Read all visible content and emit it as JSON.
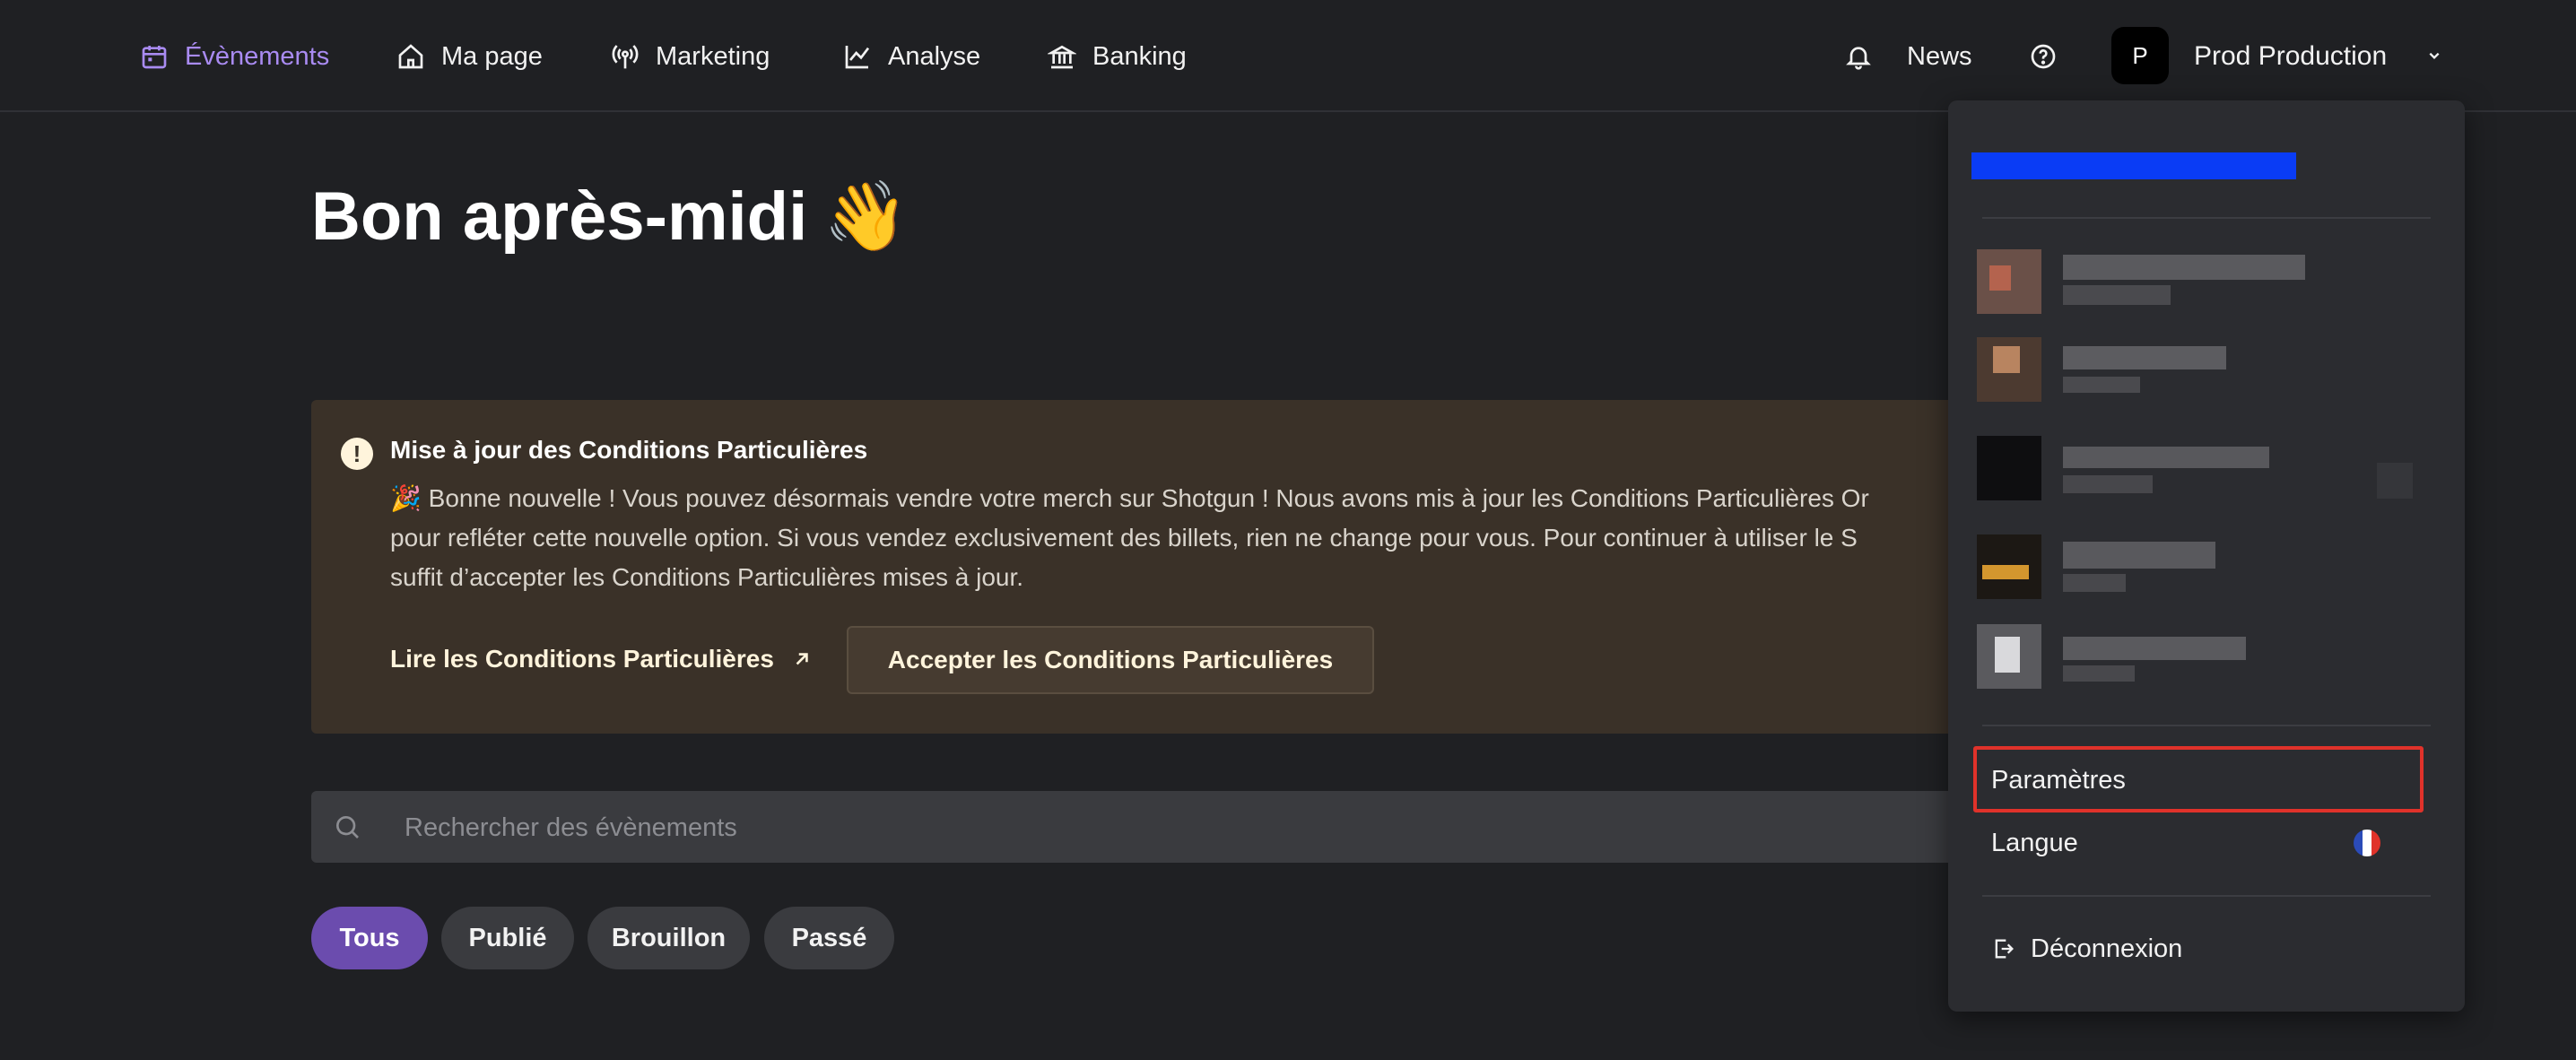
{
  "nav": {
    "events": "Évènements",
    "mypage": "Ma page",
    "marketing": "Marketing",
    "analyse": "Analyse",
    "banking": "Banking",
    "news": "News",
    "account_initial": "P",
    "account_name": "Prod Production"
  },
  "greeting": "Bon après-midi",
  "greeting_emoji": "👋",
  "banner": {
    "title": "Mise à jour des Conditions Particulières",
    "body_lines": [
      "🎉 Bonne nouvelle ! Vous pouvez désormais vendre votre merch sur Shotgun ! Nous avons mis à jour les Conditions Particulières Or",
      "pour refléter cette nouvelle option. Si vous vendez exclusivement des billets, rien ne change pour vous. Pour continuer à utiliser le S",
      "suffit d’accepter les Conditions Particulières mises à jour."
    ],
    "read_link": "Lire les Conditions Particulières",
    "accept_button": "Accepter les Conditions Particulières"
  },
  "search": {
    "placeholder": "Rechercher des évènements"
  },
  "filters": [
    "Tous",
    "Publié",
    "Brouillon",
    "Passé"
  ],
  "dropdown": {
    "settings": "Paramètres",
    "language": "Langue",
    "logout": "Déconnexion"
  },
  "colors": {
    "accent": "#a98bf2",
    "active_chip": "#6b4cae",
    "highlight": "#e0322a",
    "blue_bar": "#0a3cf5"
  }
}
